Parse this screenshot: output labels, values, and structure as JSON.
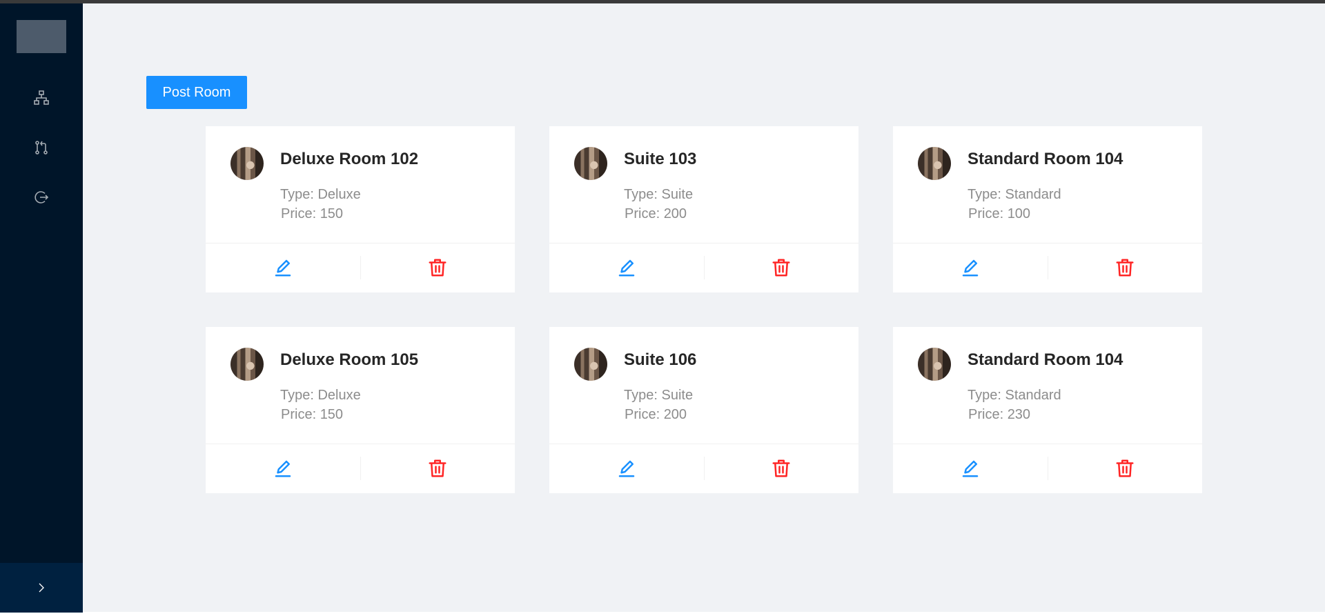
{
  "sidebar": {
    "menu": [
      {
        "icon": "cluster-icon"
      },
      {
        "icon": "pull-request-icon"
      },
      {
        "icon": "logout-icon"
      }
    ],
    "collapse_icon": "chevron-right-icon"
  },
  "toolbar": {
    "post_label": "Post Room"
  },
  "labels": {
    "type_prefix": "Type: ",
    "price_prefix": "Price: "
  },
  "rooms": [
    {
      "title": "Deluxe Room 102",
      "type": "Deluxe",
      "price": "150"
    },
    {
      "title": "Suite 103",
      "type": "Suite",
      "price": "200"
    },
    {
      "title": "Standard Room 104",
      "type": "Standard",
      "price": "100"
    },
    {
      "title": "Deluxe Room 105",
      "type": "Deluxe",
      "price": "150"
    },
    {
      "title": "Suite 106",
      "type": "Suite",
      "price": "200"
    },
    {
      "title": "Standard Room 104",
      "type": "Standard",
      "price": "230"
    }
  ],
  "colors": {
    "sidebar": "#001529",
    "primary": "#1890ff",
    "danger": "#ff2424",
    "background": "#f0f2f5"
  }
}
